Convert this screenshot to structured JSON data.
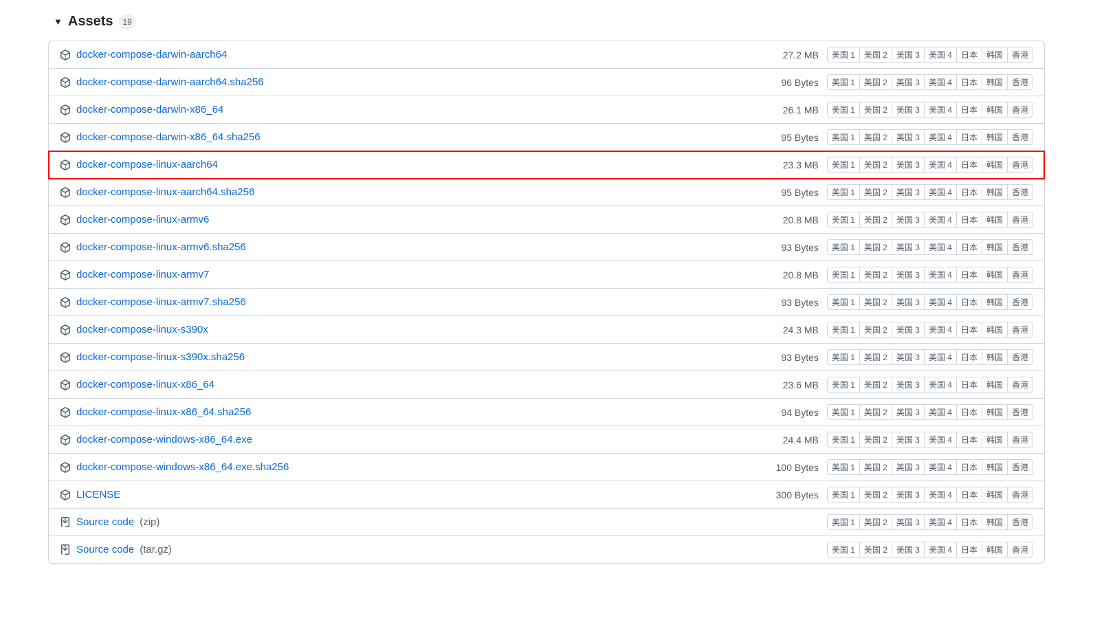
{
  "assets_title": "Assets",
  "assets_count": "19",
  "mirrors": [
    "美国 1",
    "美国 2",
    "美国 3",
    "美国 4",
    "日本",
    "韩国",
    "香港"
  ],
  "assets": [
    {
      "icon": "package",
      "name": "docker-compose-darwin-aarch64",
      "size": "27.2 MB",
      "highlighted": false
    },
    {
      "icon": "package",
      "name": "docker-compose-darwin-aarch64.sha256",
      "size": "96 Bytes",
      "highlighted": false
    },
    {
      "icon": "package",
      "name": "docker-compose-darwin-x86_64",
      "size": "26.1 MB",
      "highlighted": false
    },
    {
      "icon": "package",
      "name": "docker-compose-darwin-x86_64.sha256",
      "size": "95 Bytes",
      "highlighted": false
    },
    {
      "icon": "package",
      "name": "docker-compose-linux-aarch64",
      "size": "23.3 MB",
      "highlighted": true
    },
    {
      "icon": "package",
      "name": "docker-compose-linux-aarch64.sha256",
      "size": "95 Bytes",
      "highlighted": false
    },
    {
      "icon": "package",
      "name": "docker-compose-linux-armv6",
      "size": "20.8 MB",
      "highlighted": false
    },
    {
      "icon": "package",
      "name": "docker-compose-linux-armv6.sha256",
      "size": "93 Bytes",
      "highlighted": false
    },
    {
      "icon": "package",
      "name": "docker-compose-linux-armv7",
      "size": "20.8 MB",
      "highlighted": false
    },
    {
      "icon": "package",
      "name": "docker-compose-linux-armv7.sha256",
      "size": "93 Bytes",
      "highlighted": false
    },
    {
      "icon": "package",
      "name": "docker-compose-linux-s390x",
      "size": "24.3 MB",
      "highlighted": false
    },
    {
      "icon": "package",
      "name": "docker-compose-linux-s390x.sha256",
      "size": "93 Bytes",
      "highlighted": false
    },
    {
      "icon": "package",
      "name": "docker-compose-linux-x86_64",
      "size": "23.6 MB",
      "highlighted": false
    },
    {
      "icon": "package",
      "name": "docker-compose-linux-x86_64.sha256",
      "size": "94 Bytes",
      "highlighted": false
    },
    {
      "icon": "package",
      "name": "docker-compose-windows-x86_64.exe",
      "size": "24.4 MB",
      "highlighted": false
    },
    {
      "icon": "package",
      "name": "docker-compose-windows-x86_64.exe.sha256",
      "size": "100 Bytes",
      "highlighted": false
    },
    {
      "icon": "package",
      "name": "LICENSE",
      "size": "300 Bytes",
      "highlighted": false
    },
    {
      "icon": "zip",
      "name": "Source code",
      "format": "(zip)",
      "size": "",
      "highlighted": false
    },
    {
      "icon": "zip",
      "name": "Source code",
      "format": "(tar.gz)",
      "size": "",
      "highlighted": false
    }
  ]
}
